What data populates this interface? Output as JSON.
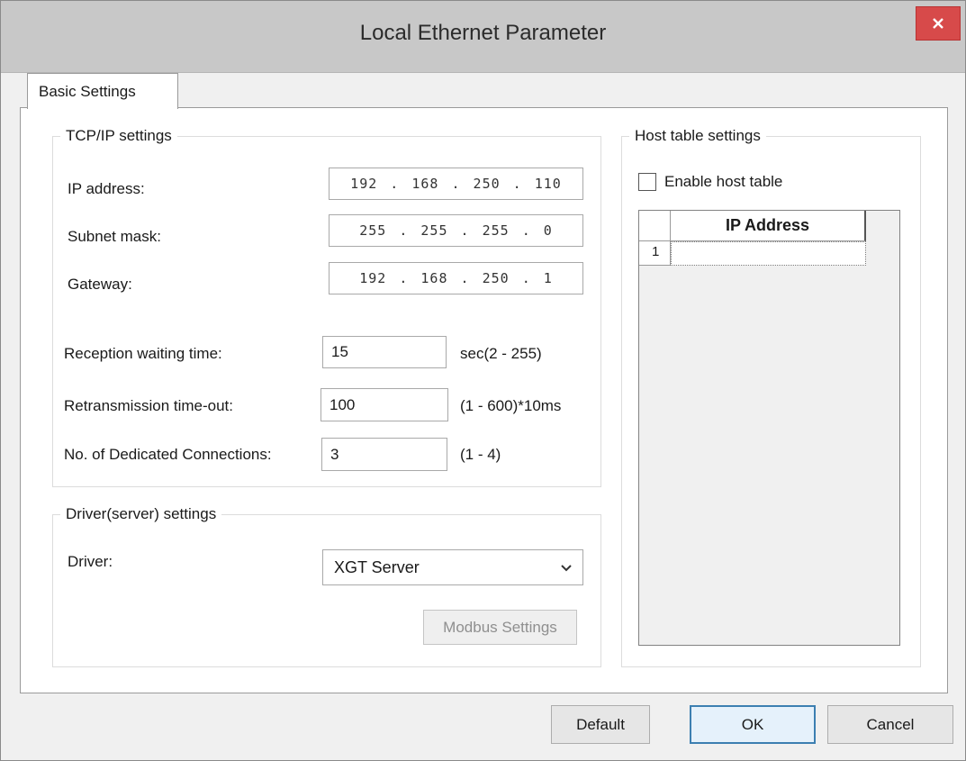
{
  "window": {
    "title": "Local Ethernet Parameter",
    "close_glyph": "✕"
  },
  "tabs": [
    {
      "label": "Basic Settings",
      "active": true
    }
  ],
  "tcpip": {
    "legend": "TCP/IP settings",
    "ip_label": "IP address:",
    "ip_value": "192 . 168 . 250 . 110",
    "subnet_label": "Subnet mask:",
    "subnet_value": "255 . 255 . 255 .  0",
    "gateway_label": "Gateway:",
    "gateway_value": "192 . 168 . 250 .  1",
    "reception_label": "Reception waiting time:",
    "reception_value": "15",
    "reception_range": "sec(2 - 255)",
    "retrans_label": "Retransmission time-out:",
    "retrans_value": "100",
    "retrans_range": "(1 - 600)*10ms",
    "dedicated_label": "No. of Dedicated Connections:",
    "dedicated_value": "3",
    "dedicated_range": "(1 - 4)"
  },
  "driver": {
    "legend": "Driver(server) settings",
    "driver_label": "Driver:",
    "driver_value": "XGT Server",
    "modbus_button": "Modbus Settings"
  },
  "host": {
    "legend": "Host table settings",
    "enable_label": "Enable host table",
    "enable_checked": false,
    "column_header": "IP Address",
    "rows": [
      {
        "num": "1",
        "ip": ""
      }
    ]
  },
  "footer": {
    "default_label": "Default",
    "ok_label": "OK",
    "cancel_label": "Cancel"
  },
  "icons": {
    "close": "close-icon",
    "dropdown": "chevron-down-icon"
  },
  "colors": {
    "close_bg": "#d74a4a",
    "ok_border": "#3c7fb1"
  }
}
